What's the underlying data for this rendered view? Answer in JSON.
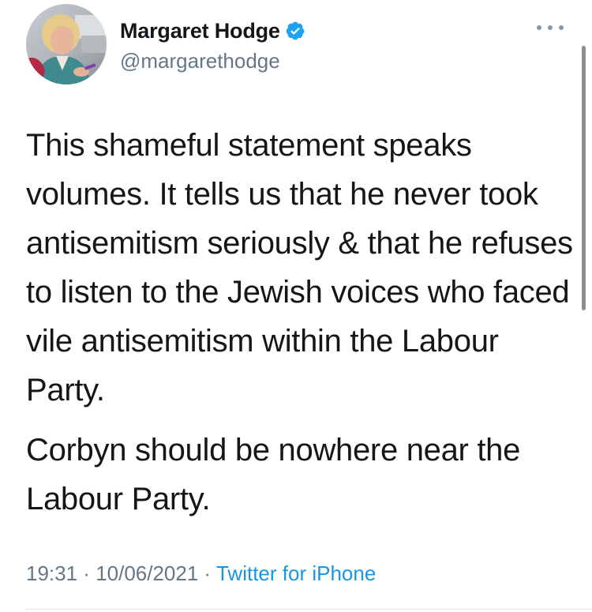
{
  "tweet": {
    "author": {
      "display_name": "Margaret Hodge",
      "handle": "@margarethodge",
      "verified": true,
      "avatar_icon": "profile-photo"
    },
    "body": {
      "paragraph_1": "This shameful statement speaks volumes. It tells us that he never took antisemitism seriously & that he refuses to listen to the Jewish voices who faced vile antisemitism within the Labour Party.",
      "paragraph_2": "Corbyn should be nowhere near the Labour Party."
    },
    "meta": {
      "time": "19:31",
      "separator": " · ",
      "date": "10/06/2021",
      "source": "Twitter for iPhone"
    },
    "icons": {
      "verified": "verified-badge-icon",
      "more": "more-options-icon"
    },
    "colors": {
      "text": "#14171a",
      "secondary": "#657786",
      "link": "#1b95e0",
      "verified": "#1da1f2"
    }
  }
}
